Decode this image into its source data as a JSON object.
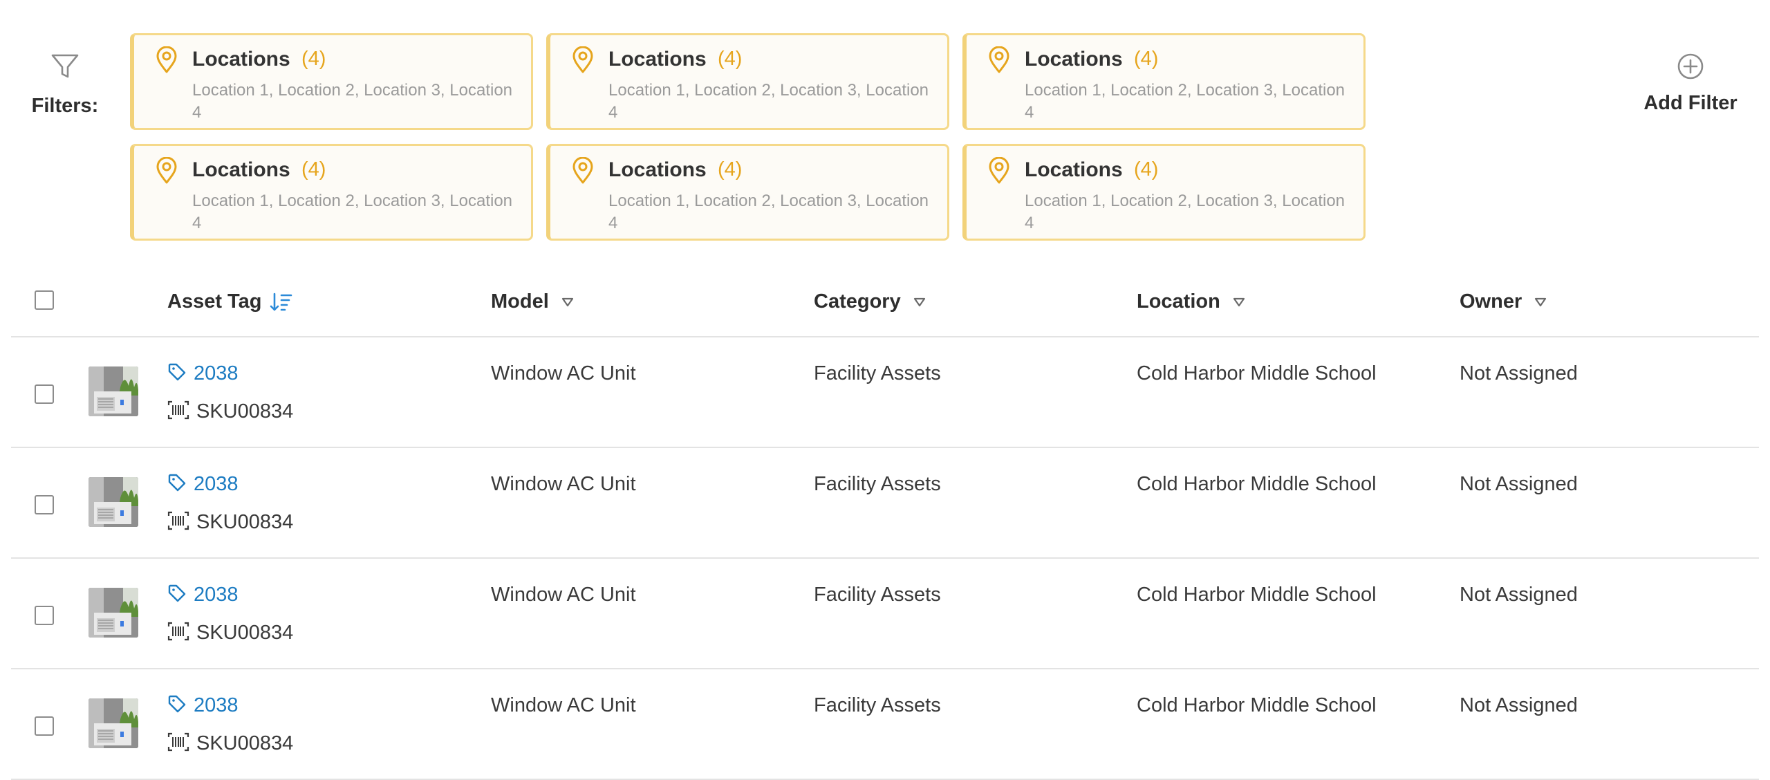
{
  "filters": {
    "label": "Filters:",
    "add_filter_label": "Add Filter",
    "chips": [
      {
        "title": "Locations",
        "count": "(4)",
        "values": "Location 1, Location 2, Location 3, Location 4"
      },
      {
        "title": "Locations",
        "count": "(4)",
        "values": "Location 1, Location 2, Location 3, Location 4"
      },
      {
        "title": "Locations",
        "count": "(4)",
        "values": "Location 1, Location 2, Location 3, Location 4"
      },
      {
        "title": "Locations",
        "count": "(4)",
        "values": "Location 1, Location 2, Location 3, Location 4"
      },
      {
        "title": "Locations",
        "count": "(4)",
        "values": "Location 1, Location 2, Location 3, Location 4"
      },
      {
        "title": "Locations",
        "count": "(4)",
        "values": "Location 1, Location 2, Location 3, Location 4"
      }
    ]
  },
  "table": {
    "columns": {
      "asset_tag": "Asset Tag",
      "model": "Model",
      "category": "Category",
      "location": "Location",
      "owner": "Owner"
    },
    "rows": [
      {
        "asset_tag": "2038",
        "sku": "SKU00834",
        "model": "Window AC Unit",
        "category": "Facility Assets",
        "location": "Cold Harbor Middle School",
        "owner": "Not Assigned"
      },
      {
        "asset_tag": "2038",
        "sku": "SKU00834",
        "model": "Window AC Unit",
        "category": "Facility Assets",
        "location": "Cold Harbor Middle School",
        "owner": "Not Assigned"
      },
      {
        "asset_tag": "2038",
        "sku": "SKU00834",
        "model": "Window AC Unit",
        "category": "Facility Assets",
        "location": "Cold Harbor Middle School",
        "owner": "Not Assigned"
      },
      {
        "asset_tag": "2038",
        "sku": "SKU00834",
        "model": "Window AC Unit",
        "category": "Facility Assets",
        "location": "Cold Harbor Middle School",
        "owner": "Not Assigned"
      }
    ]
  },
  "icons": {
    "filter": "funnel-icon",
    "chip": "map-pin-icon",
    "add": "plus-circle-icon",
    "sort": "sort-descending-icon",
    "dropdown": "caret-down-icon",
    "tag": "tag-icon",
    "barcode": "barcode-icon"
  },
  "colors": {
    "accent_gold": "#e6a51d",
    "chip_border": "#f5d98a",
    "chip_bg": "#fdfbf6",
    "link_blue": "#1d7cc2",
    "divider": "#e3e3e3"
  }
}
